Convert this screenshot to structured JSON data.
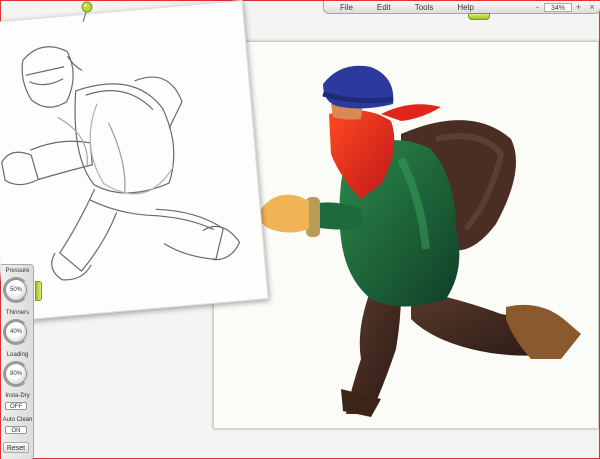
{
  "menu": {
    "items": [
      "File",
      "Edit",
      "Tools",
      "Help"
    ],
    "zoom": {
      "decrease": "-",
      "value": "34%",
      "increase": "+"
    },
    "close": "×"
  },
  "toolpanel": {
    "pressure": {
      "label": "Pressure",
      "value": "50%"
    },
    "thinners": {
      "label": "Thinners",
      "value": "40%"
    },
    "loading": {
      "label": "Loading",
      "value": "80%"
    },
    "insta_dry": {
      "label": "Insta-Dry",
      "value": "OFF"
    },
    "auto_clean": {
      "label": "Auto Clean",
      "value": "ON"
    },
    "reset": "Reset"
  },
  "colors": {
    "accent_green": "#9bc124",
    "hat_blue": "#2c3a9e",
    "mask_red": "#e0261b",
    "coat_green": "#1f6b3c",
    "skin": "#f0b454",
    "sack_brown": "#4a2e24",
    "frame_red": "#dd3333"
  }
}
